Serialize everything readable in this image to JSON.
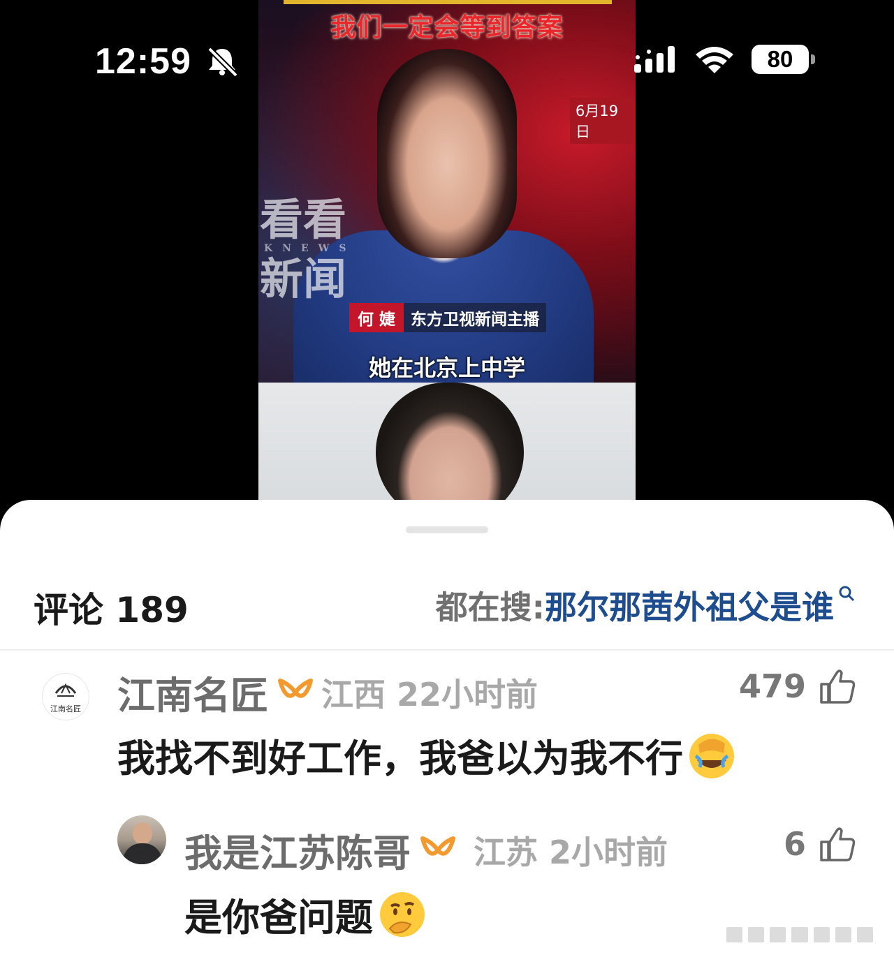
{
  "status_bar": {
    "time": "12:59",
    "battery": "80"
  },
  "video": {
    "title": "我们一定会等到答案",
    "date": "6月19日",
    "watermark_line1": "看看",
    "watermark_knews": "KNEWS",
    "watermark_line2": "新闻",
    "name_tag": "何 婕",
    "name_title": "东方卫视新闻主播",
    "subtitle": "她在北京上中学"
  },
  "comments_panel": {
    "header": "评论 189",
    "search_prefix": "都在搜:",
    "search_query": "那尔那茜外祖父是谁"
  },
  "comments": [
    {
      "username": "江南名匠",
      "avatar_text": "江南名匠",
      "location_time": "江西 22小时前",
      "likes": "479",
      "text": "我找不到好工作，我爸以为我不行"
    },
    {
      "username": "我是江苏陈哥",
      "location_time": "江苏 2小时前",
      "likes": "6",
      "text": "是你爸问题"
    }
  ],
  "colors": {
    "vip_orange": "#f29a2e",
    "link_blue": "#1e4d8f",
    "news_red": "#c4162a"
  }
}
